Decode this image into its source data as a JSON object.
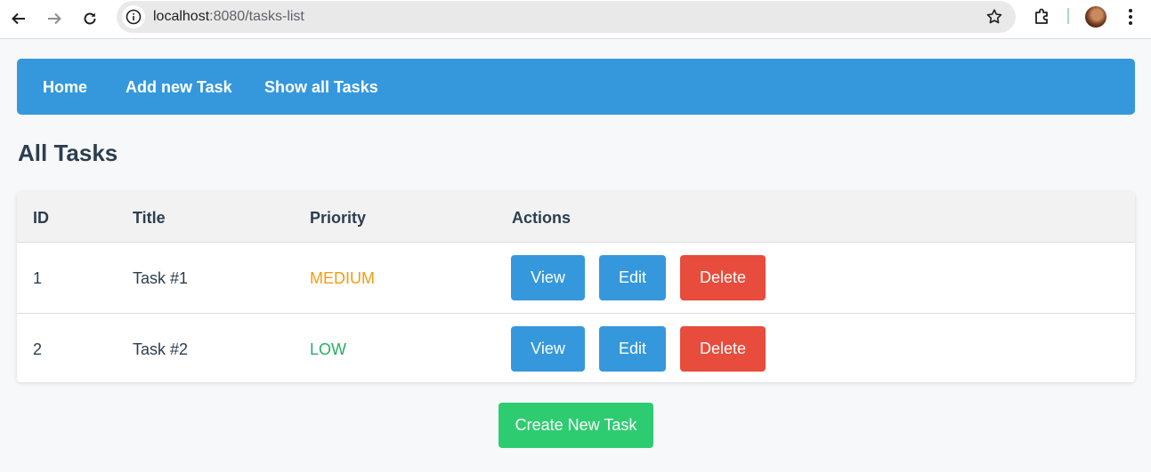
{
  "browser": {
    "url_host": "localhost",
    "url_rest": ":8080/tasks-list",
    "icons": [
      "back-arrow-icon",
      "forward-arrow-icon",
      "reload-icon",
      "site-info-icon",
      "bookmark-star-icon",
      "extensions-icon",
      "profile-avatar",
      "kebab-menu-icon"
    ]
  },
  "nav": {
    "home": "Home",
    "add_task": "Add new Task",
    "show_tasks": "Show all Tasks",
    "background": "#3598dc"
  },
  "page": {
    "title": "All Tasks"
  },
  "table": {
    "headers": {
      "id": "ID",
      "title": "Title",
      "priority": "Priority",
      "actions": "Actions"
    },
    "rows": [
      {
        "id": "1",
        "title": "Task #1",
        "priority": "MEDIUM",
        "priority_color": "#f39c12",
        "view": "View",
        "edit": "Edit",
        "delete": "Delete"
      },
      {
        "id": "2",
        "title": "Task #2",
        "priority": "LOW",
        "priority_color": "#27ae60",
        "view": "View",
        "edit": "Edit",
        "delete": "Delete"
      }
    ]
  },
  "create_button": "Create New Task",
  "colors": {
    "primary": "#3598dc",
    "danger": "#e74c3c",
    "success": "#2ecc71",
    "heading": "#2c3e50"
  }
}
